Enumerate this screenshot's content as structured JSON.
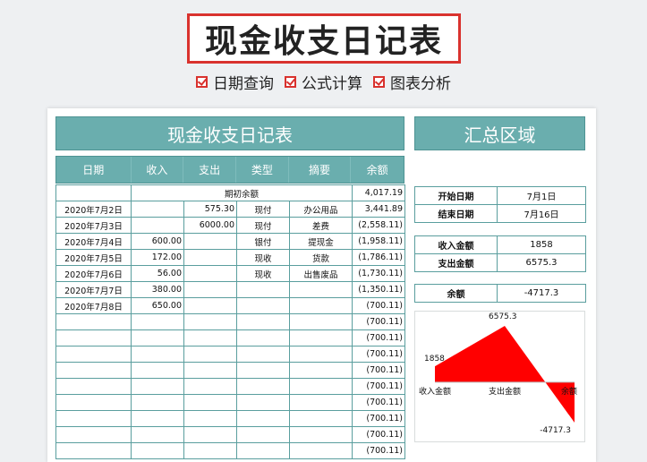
{
  "banner": {
    "title": "现金收支日记表",
    "features": [
      "日期查询",
      "公式计算",
      "图表分析"
    ]
  },
  "colors": {
    "accent": "#6aaeae",
    "negative": "#c0202a",
    "highlight": "#d9322e",
    "chart_fill": "#ff0000"
  },
  "sheet": {
    "title": "现金收支日记表",
    "summary_title": "汇总区域",
    "headers": [
      "日期",
      "收入",
      "支出",
      "类型",
      "摘要",
      "余额"
    ],
    "opening": {
      "label": "期初余额",
      "balance": "4,017.19"
    },
    "rows": [
      {
        "date": "2020年7月2日",
        "income": "",
        "expense": "575.30",
        "type": "现付",
        "note": "办公用品",
        "balance": "3,441.89",
        "neg": false
      },
      {
        "date": "2020年7月3日",
        "income": "",
        "expense": "6000.00",
        "type": "现付",
        "note": "差费",
        "balance": "(2,558.11)",
        "neg": true
      },
      {
        "date": "2020年7月4日",
        "income": "600.00",
        "expense": "",
        "type": "银付",
        "note": "提现金",
        "balance": "(1,958.11)",
        "neg": true
      },
      {
        "date": "2020年7月5日",
        "income": "172.00",
        "expense": "",
        "type": "现收",
        "note": "货款",
        "balance": "(1,786.11)",
        "neg": true
      },
      {
        "date": "2020年7月6日",
        "income": "56.00",
        "expense": "",
        "type": "现收",
        "note": "出售废品",
        "balance": "(1,730.11)",
        "neg": true
      },
      {
        "date": "2020年7月7日",
        "income": "380.00",
        "expense": "",
        "type": "",
        "note": "",
        "balance": "(1,350.11)",
        "neg": true
      },
      {
        "date": "2020年7月8日",
        "income": "650.00",
        "expense": "",
        "type": "",
        "note": "",
        "balance": "(700.11)",
        "neg": true
      },
      {
        "date": "",
        "income": "",
        "expense": "",
        "type": "",
        "note": "",
        "balance": "(700.11)",
        "neg": true
      },
      {
        "date": "",
        "income": "",
        "expense": "",
        "type": "",
        "note": "",
        "balance": "(700.11)",
        "neg": true
      },
      {
        "date": "",
        "income": "",
        "expense": "",
        "type": "",
        "note": "",
        "balance": "(700.11)",
        "neg": true
      },
      {
        "date": "",
        "income": "",
        "expense": "",
        "type": "",
        "note": "",
        "balance": "(700.11)",
        "neg": true
      },
      {
        "date": "",
        "income": "",
        "expense": "",
        "type": "",
        "note": "",
        "balance": "(700.11)",
        "neg": true
      },
      {
        "date": "",
        "income": "",
        "expense": "",
        "type": "",
        "note": "",
        "balance": "(700.11)",
        "neg": true
      },
      {
        "date": "",
        "income": "",
        "expense": "",
        "type": "",
        "note": "",
        "balance": "(700.11)",
        "neg": true
      },
      {
        "date": "",
        "income": "",
        "expense": "",
        "type": "",
        "note": "",
        "balance": "(700.11)",
        "neg": true
      },
      {
        "date": "",
        "income": "",
        "expense": "",
        "type": "",
        "note": "",
        "balance": "(700.11)",
        "neg": true
      }
    ]
  },
  "summary": {
    "start_label": "开始日期",
    "start_value": "7月1日",
    "end_label": "结束日期",
    "end_value": "7月16日",
    "income_label": "收入金额",
    "income_value": "1858",
    "expense_label": "支出金额",
    "expense_value": "6575.3",
    "balance_label": "余额",
    "balance_value": "-4717.3"
  },
  "chart_data": {
    "type": "area",
    "categories": [
      "收入金额",
      "支出金额",
      "余额"
    ],
    "values": [
      1858,
      6575.3,
      -4717.3
    ],
    "data_labels": [
      "1858",
      "6575.3",
      "-4717.3"
    ],
    "ylim": [
      -4717.3,
      6575.3
    ],
    "grid": false,
    "color": "#ff0000"
  }
}
